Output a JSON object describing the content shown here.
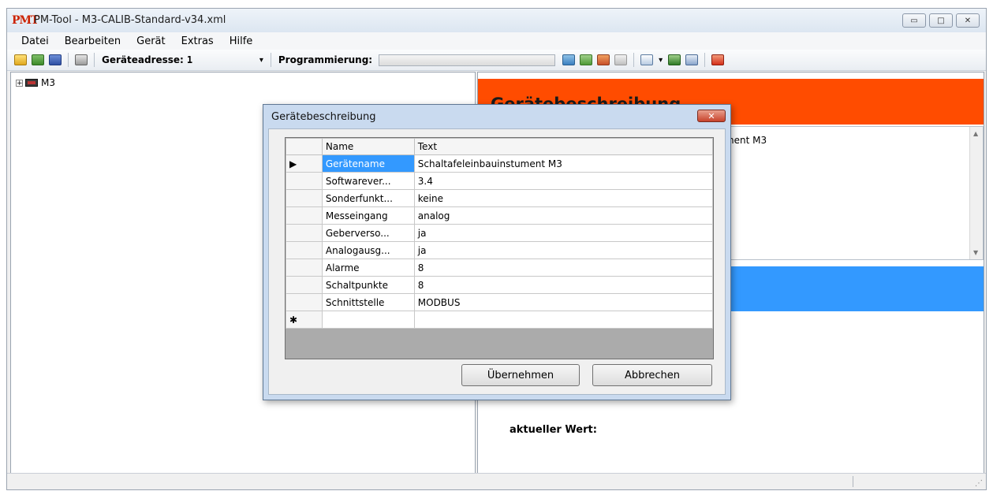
{
  "window": {
    "logo": "PMT",
    "title": "PM-Tool - M3-CALIB-Standard-v34.xml",
    "controls": {
      "minimize": "▭",
      "maximize": "□",
      "close": "✕"
    }
  },
  "menu": {
    "items": [
      "Datei",
      "Bearbeiten",
      "Gerät",
      "Extras",
      "Hilfe"
    ]
  },
  "toolbar": {
    "address_label": "Geräteadresse:",
    "address_value": "1",
    "dropdown_arrow": "▾",
    "programming_label": "Programmierung:",
    "progress": 0
  },
  "tree": {
    "expander": "+",
    "root_label": "M3"
  },
  "right_panel": {
    "header": "Gerätebeschreibung",
    "description_visible": "nent M3",
    "scroll_up": "▲",
    "scroll_down": "▼",
    "current_value_label": "aktueller Wert:",
    "header_color": "#ff4c00",
    "band_color": "#3399ff"
  },
  "status": {
    "grip": "⋰"
  },
  "dialog": {
    "title": "Gerätebeschreibung",
    "close_label": "✕",
    "columns": {
      "name": "Name",
      "text": "Text"
    },
    "rows": [
      {
        "marker": "▶",
        "name": "Gerätename",
        "text": "Schaltafeleinbauinstument M3"
      },
      {
        "marker": "",
        "name": "Softwarever...",
        "text": "3.4"
      },
      {
        "marker": "",
        "name": "Sonderfunkt...",
        "text": "keine"
      },
      {
        "marker": "",
        "name": "Messeingang",
        "text": "analog"
      },
      {
        "marker": "",
        "name": "Geberverso...",
        "text": "ja"
      },
      {
        "marker": "",
        "name": "Analogausg...",
        "text": "ja"
      },
      {
        "marker": "",
        "name": "Alarme",
        "text": "8"
      },
      {
        "marker": "",
        "name": "Schaltpunkte",
        "text": "8"
      },
      {
        "marker": "",
        "name": "Schnittstelle",
        "text": "MODBUS"
      }
    ],
    "new_row_marker": "✱",
    "ok_label": "Übernehmen",
    "cancel_label": "Abbrechen",
    "selection_color": "#3399ff"
  }
}
